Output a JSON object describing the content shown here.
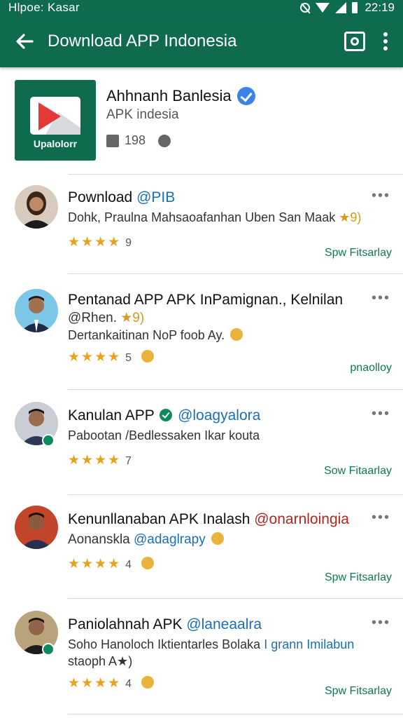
{
  "status_bar": {
    "left_text": "Hlpoe: Kasar",
    "time": "22:19"
  },
  "app_bar": {
    "title": "Download APP Indonesia"
  },
  "app_header": {
    "icon_label": "Upalolorr",
    "name": "Ahhnanh Banlesia",
    "subtitle": "APK indesia",
    "meta_count": "198"
  },
  "items": [
    {
      "title": "Pownload​ ",
      "handle": "@PIB",
      "body": "Dohk, Praulna Mahsaoafanhan Uben San Maak",
      "body_emoji": "★9)",
      "rating_count": "9",
      "action": "Spw Fitsarlay",
      "menu": "•••"
    },
    {
      "title": "Pentanad APP APK InPamignan., Kelnilan",
      "handle": "@Rhen.",
      "handle_emoji": " ★9)",
      "body": "Dertankaitinan NoP foob Ay.",
      "rating_count": "5",
      "action": "pnaolloy",
      "menu": "•••"
    },
    {
      "title": "Kanulan APP",
      "handle": "@loagyalora",
      "body": "Pabootan /Bedlessaken Ikar kouta",
      "rating_count": "7",
      "action": "Sow Fitaarlay",
      "menu": "•••"
    },
    {
      "title": "Kenunllanaban APK Inalash",
      "handle": "@onarnloingia",
      "body": "Aonanskla",
      "body_handle": "@adaglrapy",
      "rating_count": "4",
      "action": "Spw Fitsarlay",
      "menu": "•••"
    },
    {
      "title": "Paniolahnah APK",
      "handle": "@laneaalra",
      "body": "Soho Hanoloch Iktientarles Bolaka",
      "body_handle": "I grann Imilabun",
      "body2": "staoph A★)",
      "rating_count": "4",
      "action": "Spw Fitsarlay",
      "menu": "•••"
    }
  ],
  "colors": {
    "primary": "#0e6b4e",
    "star": "#e9a21e",
    "link": "#1a6fb8",
    "action": "#0e7a52"
  }
}
